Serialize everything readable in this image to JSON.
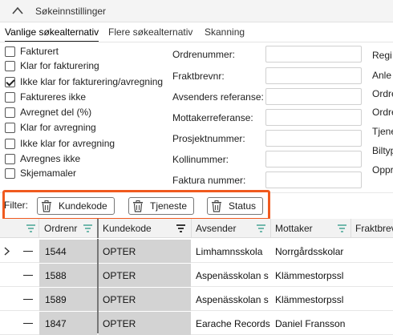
{
  "header": {
    "title": "Søkeinnstillinger"
  },
  "tabs": [
    {
      "label": "Vanlige søkealternativ",
      "active": true
    },
    {
      "label": "Flere søkealternativ",
      "active": false
    },
    {
      "label": "Skanning",
      "active": false
    }
  ],
  "checkboxes": [
    {
      "label": "Fakturert",
      "checked": false
    },
    {
      "label": "Klar for fakturering",
      "checked": false
    },
    {
      "label": "Ikke klar for fakturering/avregning",
      "checked": true
    },
    {
      "label": "Faktureres ikke",
      "checked": false
    },
    {
      "label": "Avregnet del (%)",
      "checked": false
    },
    {
      "label": "Klar for avregning",
      "checked": false
    },
    {
      "label": "Ikke klar for avregning",
      "checked": false
    },
    {
      "label": "Avregnes ikke",
      "checked": false
    },
    {
      "label": "Skjemamaler",
      "checked": false
    }
  ],
  "fields": [
    {
      "label": "Ordrenummer:",
      "value": ""
    },
    {
      "label": "Fraktbrevnr:",
      "value": ""
    },
    {
      "label": "Avsenders referanse:",
      "value": ""
    },
    {
      "label": "Mottakerreferanse:",
      "value": ""
    },
    {
      "label": "Prosjektnummer:",
      "value": ""
    },
    {
      "label": "Kollinummer:",
      "value": ""
    },
    {
      "label": "Faktura nummer:",
      "value": ""
    }
  ],
  "right_fields": [
    "Regi",
    "Anle",
    "Ordre",
    "Ordre",
    "Tjene",
    "Biltyp",
    "Oppr"
  ],
  "filter": {
    "label": "Filter:",
    "chips": [
      "Kundekode",
      "Tjeneste",
      "Status"
    ]
  },
  "grid": {
    "columns": [
      "Ordrenr",
      "Kundekode",
      "Avsender",
      "Mottaker",
      "Fraktbrev"
    ],
    "rows": [
      {
        "ordrenr": "1544",
        "kundekode": "OPTER",
        "avsender": "Limhamnsskola",
        "mottaker": "Norrgårdsskolar"
      },
      {
        "ordrenr": "1588",
        "kundekode": "OPTER",
        "avsender": "Aspenässkolan s",
        "mottaker": "Klämmestorpssl"
      },
      {
        "ordrenr": "1589",
        "kundekode": "OPTER",
        "avsender": "Aspenässkolan s",
        "mottaker": "Klämmestorpssl"
      },
      {
        "ordrenr": "1847",
        "kundekode": "OPTER",
        "avsender": "Earache Records",
        "mottaker": "Daniel Fransson"
      }
    ]
  },
  "colors": {
    "accent_orange": "#f05a1f",
    "grid_header": "#f2f2f2",
    "selected_column": "#d3d3d3",
    "filter_icon": "#3a9f8f"
  }
}
